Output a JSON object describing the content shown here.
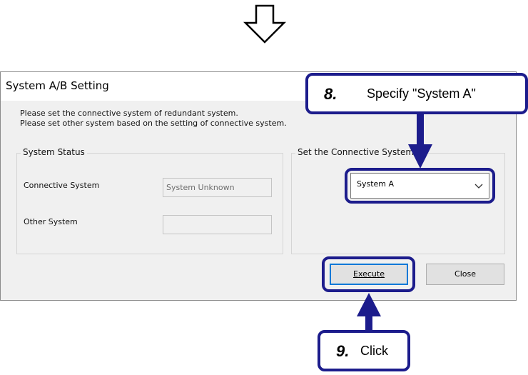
{
  "dialog": {
    "title": "System A/B Setting",
    "instructions": [
      "Please set the connective system of redundant system.",
      "Please set other system based on the setting of connective system."
    ],
    "system_status": {
      "legend": "System Status",
      "connective_label": "Connective System",
      "connective_value": "System Unknown",
      "other_label": "Other System",
      "other_value": ""
    },
    "connective_panel": {
      "legend": "Set the Connective System",
      "selected": "System A"
    },
    "buttons": {
      "execute": "Execute",
      "close": "Close"
    }
  },
  "annotations": {
    "step8": {
      "number": "8.",
      "text": "Specify \"System A\""
    },
    "step9": {
      "number": "9.",
      "text": "Click"
    }
  },
  "colors": {
    "callout_border": "#1c1c8c",
    "arrow": "#1c1c8c",
    "dialog_bg": "#f0f0f0",
    "button_focus": "#0078d7"
  },
  "icons": [
    "down-arrow-outline-icon",
    "chevron-down-icon",
    "arrow-down-icon",
    "arrow-up-icon"
  ]
}
